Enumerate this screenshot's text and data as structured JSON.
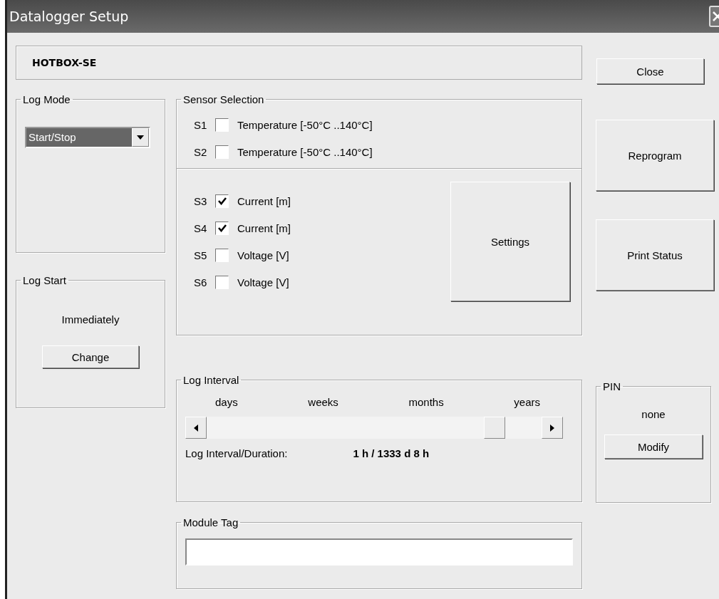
{
  "window": {
    "title": "Datalogger Setup"
  },
  "device_name": "HOTBOX-SE",
  "buttons": {
    "close": "Close",
    "reprogram": "Reprogram",
    "print_status": "Print Status"
  },
  "log_mode": {
    "label": "Log Mode",
    "value": "Start/Stop"
  },
  "log_start": {
    "label": "Log Start",
    "value": "Immediately",
    "button": "Change"
  },
  "sensor_selection": {
    "label": "Sensor Selection",
    "groups": [
      {
        "sensors": [
          {
            "id": "S1",
            "checked": false,
            "label": "Temperature [-50°C ..140°C]"
          },
          {
            "id": "S2",
            "checked": false,
            "label": "Temperature [-50°C ..140°C]"
          }
        ]
      },
      {
        "sensors": [
          {
            "id": "S3",
            "checked": true,
            "label": "Current [m]"
          },
          {
            "id": "S4",
            "checked": true,
            "label": "Current [m]"
          },
          {
            "id": "S5",
            "checked": false,
            "label": "Voltage [V]"
          },
          {
            "id": "S6",
            "checked": false,
            "label": "Voltage [V]"
          }
        ],
        "button": "Settings"
      }
    ]
  },
  "log_interval": {
    "label": "Log Interval",
    "scale": [
      "days",
      "weeks",
      "months",
      "years"
    ],
    "level": 0.86,
    "reading_label": "Log Interval/Duration:",
    "reading": "1 h  / 1333 d 8 h"
  },
  "pin": {
    "label": "PIN",
    "value": "none",
    "button": "Modify"
  },
  "module_tag": {
    "label": "Module Tag"
  }
}
